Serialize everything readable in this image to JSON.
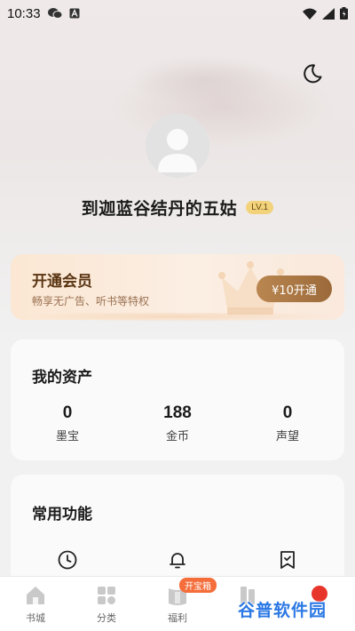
{
  "status_bar": {
    "time": "10:33"
  },
  "profile": {
    "username": "到迦蓝谷结丹的五姑",
    "level": "LV.1"
  },
  "vip": {
    "title": "开通会员",
    "subtitle": "畅享无广告、听书等特权",
    "button": "¥10开通"
  },
  "assets": {
    "title": "我的资产",
    "items": [
      {
        "value": "0",
        "label": "墨宝"
      },
      {
        "value": "188",
        "label": "金币"
      },
      {
        "value": "0",
        "label": "声望"
      }
    ]
  },
  "functions": {
    "title": "常用功能",
    "icons": [
      "clock-icon",
      "bell-icon",
      "bookmark-icon"
    ]
  },
  "bottom_nav": {
    "items": [
      {
        "label": "书城",
        "icon": "home-icon"
      },
      {
        "label": "分类",
        "icon": "grid-icon"
      },
      {
        "label": "福利",
        "icon": "gift-icon"
      },
      {
        "label": "",
        "icon": "bookshelf-icon"
      },
      {
        "label": "",
        "icon": "profile-icon"
      }
    ],
    "welfare_badge": "开宝箱"
  },
  "watermark": "谷普软件园",
  "colors": {
    "accent": "#a8743f",
    "badge": "#f46d3a",
    "level_badge": "#f2d37b"
  }
}
